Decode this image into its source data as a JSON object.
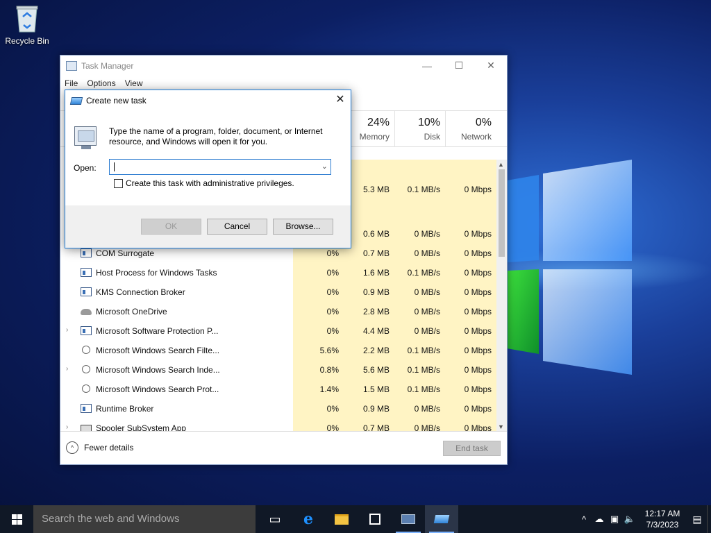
{
  "desktop": {
    "recycle_bin_label": "Recycle Bin"
  },
  "task_manager": {
    "title": "Task Manager",
    "menu": [
      "File",
      "Options",
      "View"
    ],
    "columns": {
      "memory": {
        "pct": "24%",
        "label": "Memory"
      },
      "disk": {
        "pct": "10%",
        "label": "Disk"
      },
      "network": {
        "pct": "0%",
        "label": "Network"
      }
    },
    "rows": [
      {
        "name": "",
        "cpu": "",
        "mem": "5.3 MB",
        "disk": "0.1 MB/s",
        "net": "0 Mbps",
        "icon": "none",
        "expand": false
      },
      {
        "name": "",
        "cpu": "",
        "mem": "0.6 MB",
        "disk": "0 MB/s",
        "net": "0 Mbps",
        "icon": "none",
        "expand": false
      },
      {
        "name": "COM Surrogate",
        "cpu": "0%",
        "mem": "0.7 MB",
        "disk": "0 MB/s",
        "net": "0 Mbps",
        "icon": "win",
        "expand": false
      },
      {
        "name": "Host Process for Windows Tasks",
        "cpu": "0%",
        "mem": "1.6 MB",
        "disk": "0.1 MB/s",
        "net": "0 Mbps",
        "icon": "win",
        "expand": false
      },
      {
        "name": "KMS Connection Broker",
        "cpu": "0%",
        "mem": "0.9 MB",
        "disk": "0 MB/s",
        "net": "0 Mbps",
        "icon": "win",
        "expand": false
      },
      {
        "name": "Microsoft OneDrive",
        "cpu": "0%",
        "mem": "2.8 MB",
        "disk": "0 MB/s",
        "net": "0 Mbps",
        "icon": "cloud",
        "expand": false
      },
      {
        "name": "Microsoft Software Protection P...",
        "cpu": "0%",
        "mem": "4.4 MB",
        "disk": "0 MB/s",
        "net": "0 Mbps",
        "icon": "win",
        "expand": true
      },
      {
        "name": "Microsoft Windows Search Filte...",
        "cpu": "5.6%",
        "mem": "2.2 MB",
        "disk": "0.1 MB/s",
        "net": "0 Mbps",
        "icon": "user",
        "expand": false
      },
      {
        "name": "Microsoft Windows Search Inde...",
        "cpu": "0.8%",
        "mem": "5.6 MB",
        "disk": "0.1 MB/s",
        "net": "0 Mbps",
        "icon": "user",
        "expand": true
      },
      {
        "name": "Microsoft Windows Search Prot...",
        "cpu": "1.4%",
        "mem": "1.5 MB",
        "disk": "0.1 MB/s",
        "net": "0 Mbps",
        "icon": "user",
        "expand": false
      },
      {
        "name": "Runtime Broker",
        "cpu": "0%",
        "mem": "0.9 MB",
        "disk": "0 MB/s",
        "net": "0 Mbps",
        "icon": "win",
        "expand": false
      },
      {
        "name": "Spooler SubSystem App",
        "cpu": "0%",
        "mem": "0.7 MB",
        "disk": "0 MB/s",
        "net": "0 Mbps",
        "icon": "printer",
        "expand": true
      }
    ],
    "footer": {
      "fewer_details": "Fewer details",
      "end_task": "End task"
    }
  },
  "run_dialog": {
    "title": "Create new task",
    "description": "Type the name of a program, folder, document, or Internet resource, and Windows will open it for you.",
    "open_label": "Open:",
    "open_value": "",
    "admin_checkbox_label": "Create this task with administrative privileges.",
    "admin_checked": false,
    "ok_label": "OK",
    "cancel_label": "Cancel",
    "browse_label": "Browse..."
  },
  "taskbar": {
    "search_placeholder": "Search the web and Windows",
    "time": "12:17 AM",
    "date": "7/3/2023",
    "accent": "#7db4ff"
  }
}
